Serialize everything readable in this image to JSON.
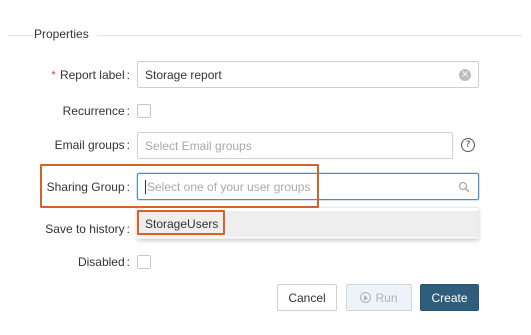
{
  "section": {
    "legend": "Properties"
  },
  "form": {
    "report_label": {
      "label": "Report label",
      "required_mark": "*",
      "value": "Storage report"
    },
    "recurrence": {
      "label": "Recurrence",
      "checked": false
    },
    "email_groups": {
      "label": "Email groups",
      "placeholder": "Select Email groups"
    },
    "sharing_group": {
      "label": "Sharing Group",
      "placeholder": "Select one of your user groups"
    },
    "save_to_history": {
      "label": "Save to history"
    },
    "disabled": {
      "label": "Disabled",
      "checked": false
    },
    "colon": ":"
  },
  "dropdown": {
    "options": [
      "StorageUsers"
    ]
  },
  "buttons": {
    "cancel": "Cancel",
    "run": "Run",
    "create": "Create"
  },
  "colors": {
    "highlight": "#d4622a",
    "primary": "#2f5d7c",
    "required": "#d9534f",
    "focus": "#4a90c8"
  }
}
